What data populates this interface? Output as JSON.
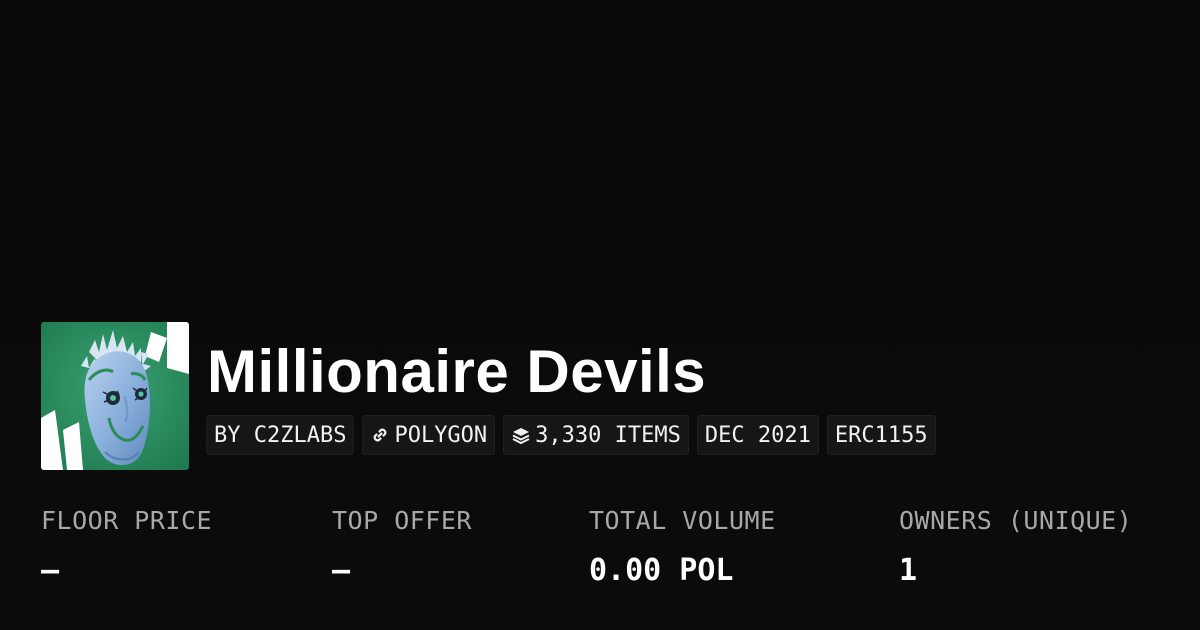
{
  "collection": {
    "title": "Millionaire Devils",
    "avatar_alt": "collection-avatar"
  },
  "badges": [
    {
      "label": "BY C2ZLABS",
      "icon": null
    },
    {
      "label": "POLYGON",
      "icon": "link-icon"
    },
    {
      "label": "3,330 ITEMS",
      "icon": "layers-icon"
    },
    {
      "label": "DEC 2021",
      "icon": null
    },
    {
      "label": "ERC1155",
      "icon": null
    }
  ],
  "stats": [
    {
      "label": "FLOOR PRICE",
      "value": "–"
    },
    {
      "label": "TOP OFFER",
      "value": "–"
    },
    {
      "label": "TOTAL VOLUME",
      "value": "0.00 POL"
    },
    {
      "label": "OWNERS (UNIQUE)",
      "value": "1"
    }
  ],
  "colors": {
    "background": "#0a0a0a",
    "badge_bg": "#161616",
    "label_gray": "#a8a8a8",
    "avatar_green": "#2e8a5e",
    "face_blue": "#8eb4dc"
  }
}
